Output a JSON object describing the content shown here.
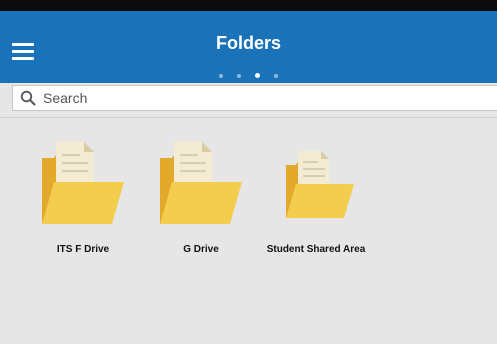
{
  "header": {
    "title": "Folders",
    "pager": {
      "pages": 4,
      "active_index": 2
    }
  },
  "search": {
    "placeholder": "Search",
    "value": ""
  },
  "folders": [
    {
      "label": "ITS F Drive",
      "icon": "folder-document-icon"
    },
    {
      "label": "G Drive",
      "icon": "folder-document-icon"
    },
    {
      "label": "Student Shared Area",
      "icon": "folder-document-icon"
    }
  ],
  "colors": {
    "appbar": "#1a72b8",
    "folder_back": "#e2a92b",
    "folder_front": "#f3cd4e",
    "paper": "#f4ecd2",
    "paper_fold": "#d9cba2"
  }
}
